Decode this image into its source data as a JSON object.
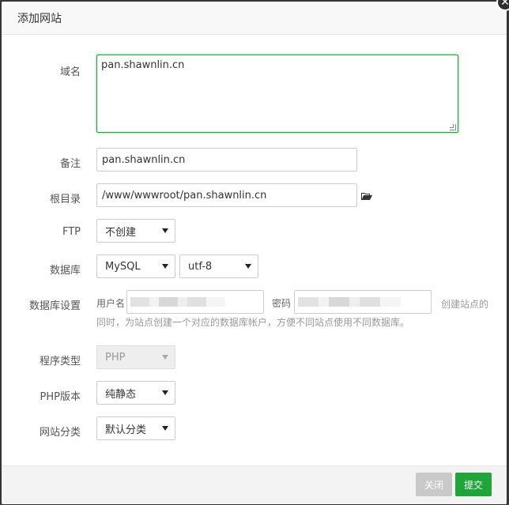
{
  "dialog": {
    "title": "添加网站",
    "close_icon": "close-icon"
  },
  "form": {
    "domain": {
      "label": "域名",
      "value": "pan.shawnlin.cn"
    },
    "note": {
      "label": "备注",
      "value": "pan.shawnlin.cn"
    },
    "root_dir": {
      "label": "根目录",
      "value": "/www/wwwroot/pan.shawnlin.cn",
      "icon": "folder-open-icon"
    },
    "ftp": {
      "label": "FTP",
      "value": "不创建"
    },
    "database": {
      "label": "数据库",
      "type_value": "MySQL",
      "charset_value": "utf-8"
    },
    "db_settings": {
      "label": "数据库设置",
      "username_label": "用户名",
      "password_label": "密码",
      "hint_line1": "创建站点的",
      "hint_line2": "同时，为站点创建一个对应的数据库帐户，方便不同站点使用不同数据库。"
    },
    "program_type": {
      "label": "程序类型",
      "value": "PHP"
    },
    "php_version": {
      "label": "PHP版本",
      "value": "纯静态"
    },
    "site_category": {
      "label": "网站分类",
      "value": "默认分类"
    }
  },
  "footer": {
    "close_label": "关闭",
    "submit_label": "提交"
  },
  "colors": {
    "accent": "#20a53a",
    "disabled_button": "#c9c9c9"
  }
}
